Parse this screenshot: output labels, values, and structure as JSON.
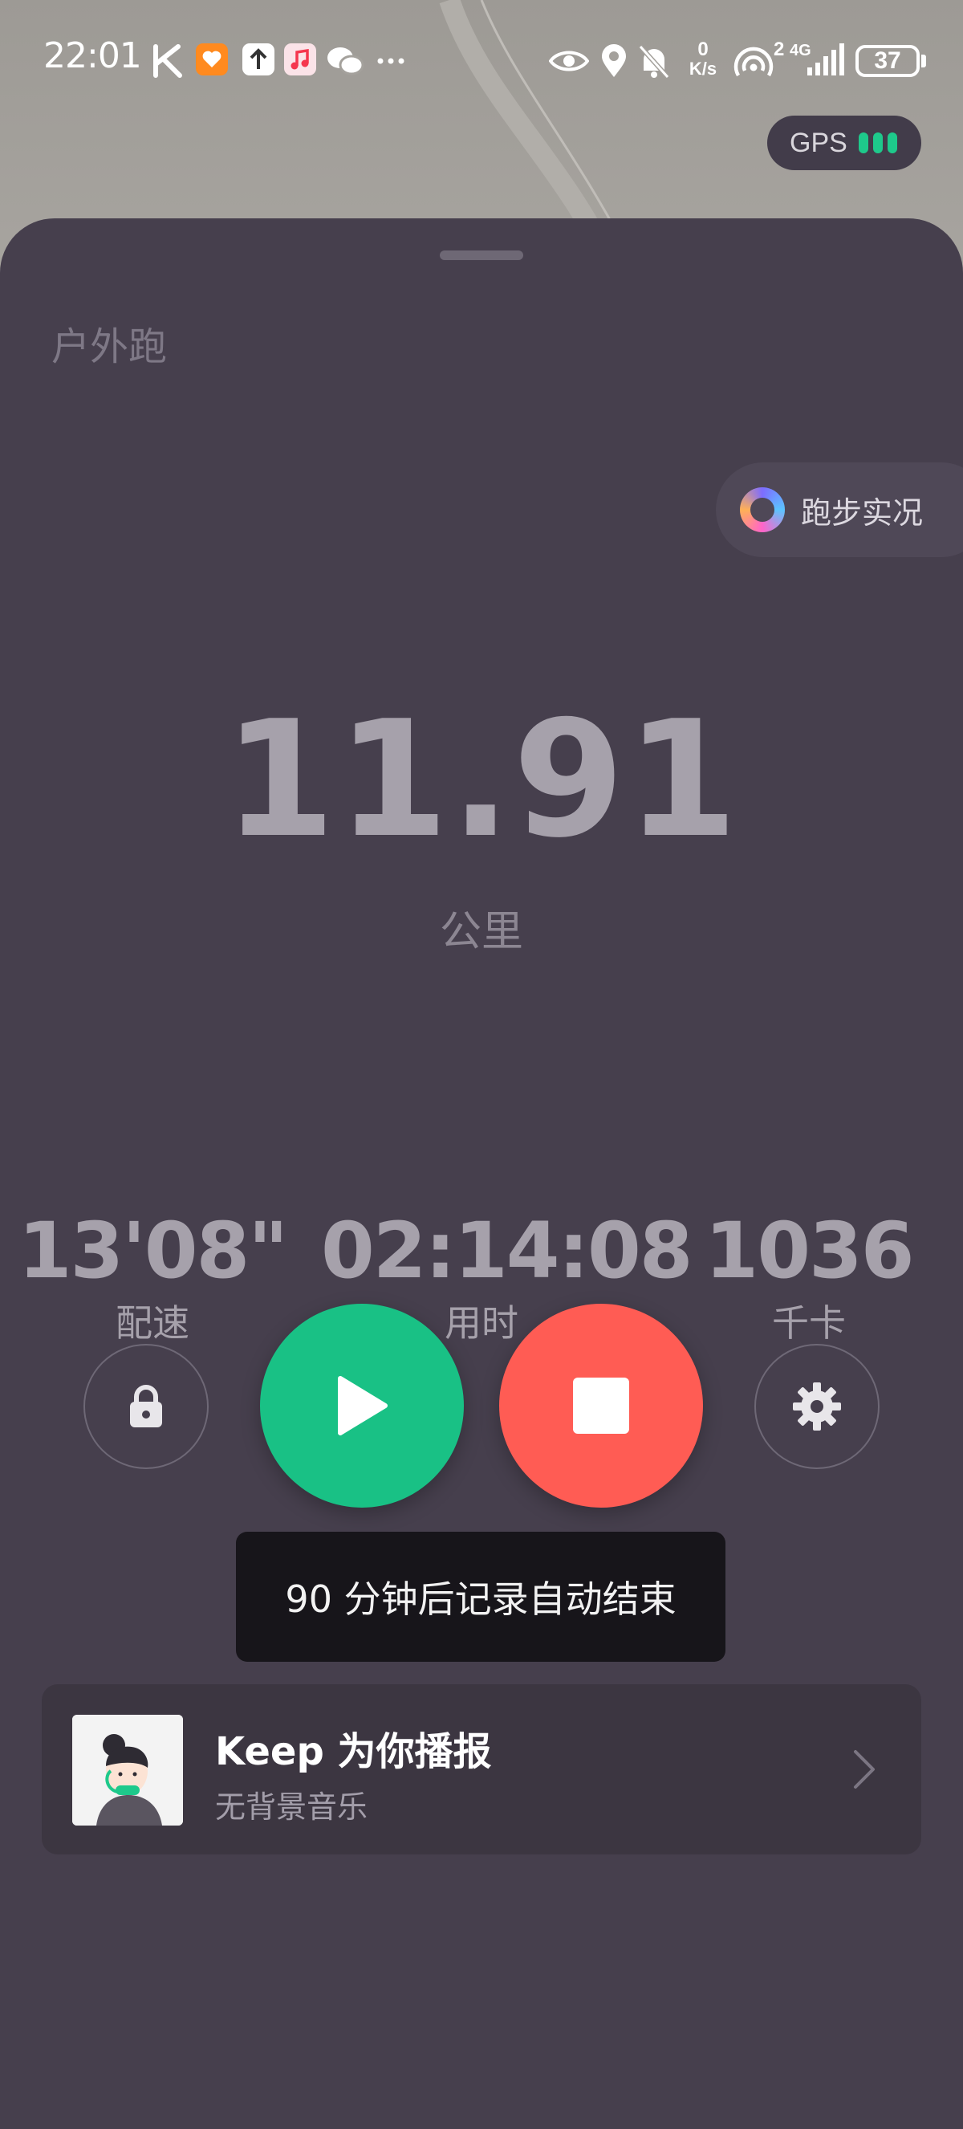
{
  "status_bar": {
    "time": "22:01",
    "network_speed_top": "0",
    "network_speed_unit": "K/s",
    "signal_badge": "2",
    "network_type": "4G",
    "battery": "37"
  },
  "gps": {
    "label": "GPS",
    "signal_level": 3
  },
  "run": {
    "type": "户外跑",
    "live_label": "跑步实况",
    "distance": "11.91",
    "distance_unit": "公里"
  },
  "stats": [
    {
      "value": "13'08\"",
      "label": "配速"
    },
    {
      "value": "02:14:08",
      "label": "用时"
    },
    {
      "value": "1036",
      "label": "千卡"
    }
  ],
  "toast": "90 分钟后记录自动结束",
  "voice": {
    "title": "Keep 为你播报",
    "subtitle": "无背景音乐"
  },
  "colors": {
    "sheet": "#463f4d",
    "resume": "#19c185",
    "stop": "#ff5c54",
    "gps_dots": "#1ec98b"
  }
}
